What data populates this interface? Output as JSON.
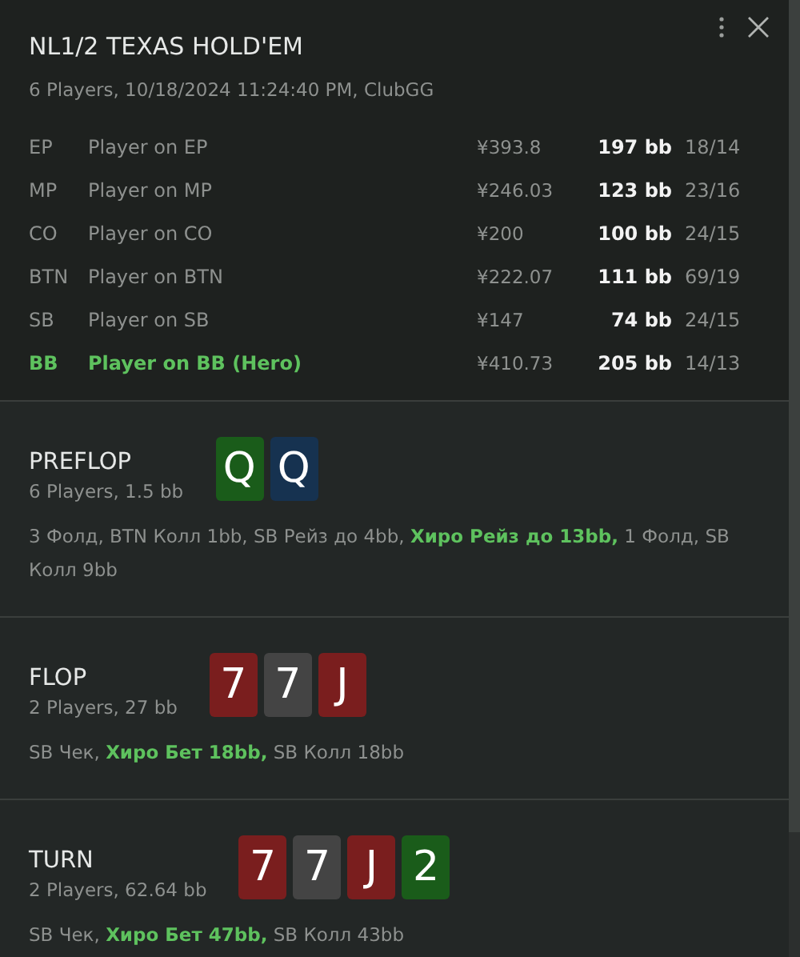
{
  "header": {
    "title": "NL1/2 TEXAS HOLD'EM",
    "subtitle": "6 Players, 10/18/2024 11:24:40 PM, ClubGG"
  },
  "players": [
    {
      "position": "EP",
      "name": "Player on EP",
      "stack": "¥393.8",
      "bb": "197 bb",
      "stats": "18/14",
      "hero": false
    },
    {
      "position": "MP",
      "name": "Player on MP",
      "stack": "¥246.03",
      "bb": "123 bb",
      "stats": "23/16",
      "hero": false
    },
    {
      "position": "CO",
      "name": "Player on CO",
      "stack": "¥200",
      "bb": "100 bb",
      "stats": "24/15",
      "hero": false
    },
    {
      "position": "BTN",
      "name": "Player on BTN",
      "stack": "¥222.07",
      "bb": "111 bb",
      "stats": "69/19",
      "hero": false
    },
    {
      "position": "SB",
      "name": "Player on SB",
      "stack": "¥147",
      "bb": "74 bb",
      "stats": "24/15",
      "hero": false
    },
    {
      "position": "BB",
      "name": "Player on BB (Hero)",
      "stack": "¥410.73",
      "bb": "205 bb",
      "stats": "14/13",
      "hero": true
    }
  ],
  "streets": [
    {
      "name": "PREFLOP",
      "info": "6 Players, 1.5 bb",
      "cards": [
        {
          "rank": "Q",
          "color": "#1a5c1a"
        },
        {
          "rank": "Q",
          "color": "#163250"
        }
      ],
      "actions": "3 Фолд, BTN Колл 1bb, SB Рейз до 4bb, **Хиро Рейз до 13bb,** 1 Фолд, SB Колл 9bb"
    },
    {
      "name": "FLOP",
      "info": "2 Players, 27 bb",
      "cards": [
        {
          "rank": "7",
          "color": "#7a1e1e"
        },
        {
          "rank": "7",
          "color": "#444444"
        },
        {
          "rank": "J",
          "color": "#7a1e1e"
        }
      ],
      "actions": "SB Чек, **Хиро Бет 18bb,** SB Колл 18bb"
    },
    {
      "name": "TURN",
      "info": "2 Players, 62.64 bb",
      "cards": [
        {
          "rank": "7",
          "color": "#7a1e1e"
        },
        {
          "rank": "7",
          "color": "#444444"
        },
        {
          "rank": "J",
          "color": "#7a1e1e"
        },
        {
          "rank": "2",
          "color": "#1a5c1a"
        }
      ],
      "actions": "SB Чек, **Хиро Бет 47bb,** SB Колл 43bb"
    }
  ]
}
